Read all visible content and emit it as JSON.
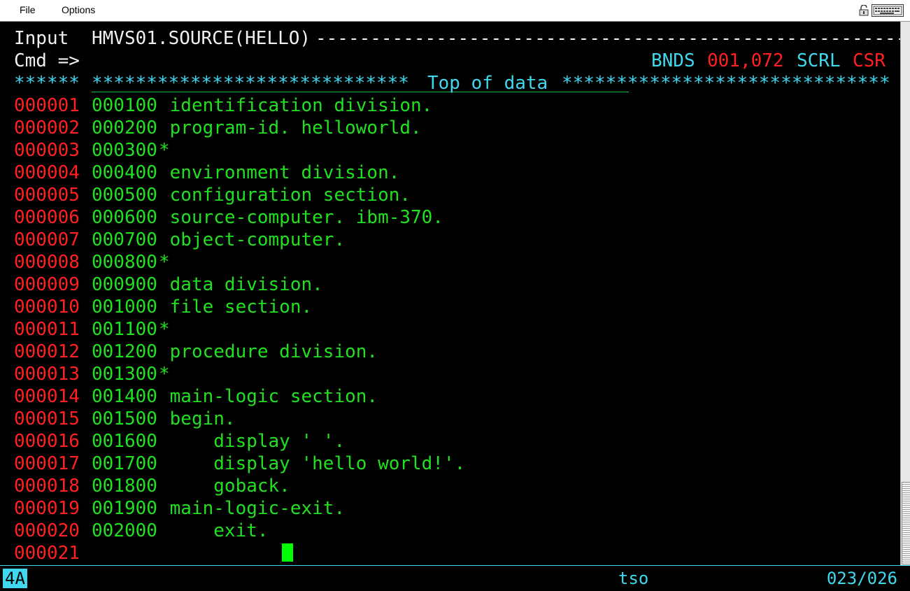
{
  "menubar": {
    "file_label": "File",
    "options_label": "Options"
  },
  "editor": {
    "mode_label": "Input",
    "dataset_title": "HMVS01.SOURCE(HELLO)",
    "title_fill": "------------------------------------------------------------",
    "cmd_label": "Cmd =>",
    "cmd_value": "",
    "bnds_label": "BNDS",
    "bnds_value": "001,072",
    "scrl_label": "SCRL",
    "scrl_value": "CSR",
    "top_line_prefix": "******",
    "top_line_stars_left": "*****************************",
    "top_line_text": "Top of data",
    "top_line_stars_right": "******************************"
  },
  "lines": [
    {
      "num": "000001",
      "seq": "000100",
      "text": " identification division."
    },
    {
      "num": "000002",
      "seq": "000200",
      "text": " program-id. helloworld."
    },
    {
      "num": "000003",
      "seq": "000300",
      "text": "*"
    },
    {
      "num": "000004",
      "seq": "000400",
      "text": " environment division."
    },
    {
      "num": "000005",
      "seq": "000500",
      "text": " configuration section."
    },
    {
      "num": "000006",
      "seq": "000600",
      "text": " source-computer. ibm-370."
    },
    {
      "num": "000007",
      "seq": "000700",
      "text": " object-computer."
    },
    {
      "num": "000008",
      "seq": "000800",
      "text": "*"
    },
    {
      "num": "000009",
      "seq": "000900",
      "text": " data division."
    },
    {
      "num": "000010",
      "seq": "001000",
      "text": " file section."
    },
    {
      "num": "000011",
      "seq": "001100",
      "text": "*"
    },
    {
      "num": "000012",
      "seq": "001200",
      "text": " procedure division."
    },
    {
      "num": "000013",
      "seq": "001300",
      "text": "*"
    },
    {
      "num": "000014",
      "seq": "001400",
      "text": " main-logic section."
    },
    {
      "num": "000015",
      "seq": "001500",
      "text": " begin."
    },
    {
      "num": "000016",
      "seq": "001600",
      "text": "     display ' '."
    },
    {
      "num": "000017",
      "seq": "001700",
      "text": "     display 'hello world!'."
    },
    {
      "num": "000018",
      "seq": "001800",
      "text": "     goback."
    },
    {
      "num": "000019",
      "seq": "001900",
      "text": " main-logic-exit."
    },
    {
      "num": "000020",
      "seq": "002000",
      "text": "     exit."
    },
    {
      "num": "000021",
      "seq": "",
      "text": ""
    }
  ],
  "status": {
    "indicator": "4A",
    "session": "tso",
    "cursor_position": "023/026"
  },
  "colors": {
    "background": "#000000",
    "text_green": "#20e020",
    "line_number_red": "#ff2020",
    "accent_cyan": "#3fd8ee",
    "text_white": "#f0f0f0",
    "cursor_green": "#00ff00"
  },
  "icons": {
    "lock": "lock-icon",
    "keyboard": "keyboard-icon"
  }
}
